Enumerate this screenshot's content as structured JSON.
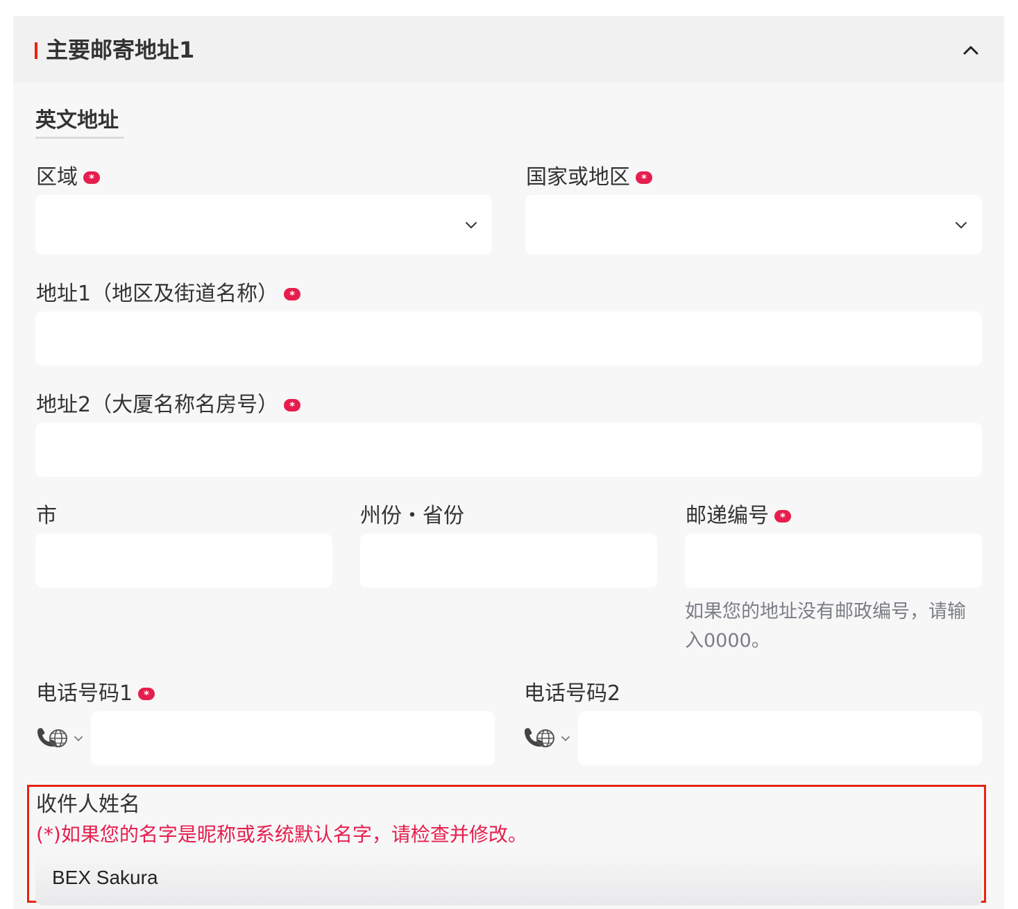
{
  "section": {
    "title": "主要邮寄地址1",
    "collapse_icon": "chevron-up-icon",
    "accent_color": "#e8230f"
  },
  "subsection": {
    "title": "英文地址"
  },
  "required_marker": "*",
  "fields": {
    "region": {
      "label": "区域",
      "value": "",
      "icon": "chevron-down-icon"
    },
    "country": {
      "label": "国家或地区",
      "value": "",
      "icon": "chevron-down-icon"
    },
    "address1": {
      "label": "地址1（地区及街道名称）",
      "value": ""
    },
    "address2": {
      "label": "地址2（大厦名称名房号）",
      "value": ""
    },
    "city": {
      "label": "市",
      "value": ""
    },
    "state": {
      "label": "州份・省份",
      "value": ""
    },
    "postal": {
      "label": "邮递编号",
      "value": "",
      "hint": "如果您的地址没有邮政编号，请输入0000。"
    },
    "phone1": {
      "label": "电话号码1",
      "value": "",
      "prefix_icon": "phone-globe-icon"
    },
    "phone2": {
      "label": "电话号码2",
      "value": "",
      "prefix_icon": "phone-globe-icon"
    },
    "recipient": {
      "label": "收件人姓名",
      "note": "(*)如果您的名字是昵称或系统默认名字，请检查并修改。",
      "value": "BEX Sakura"
    }
  },
  "colors": {
    "required_badge": "#e61e4d",
    "highlight_border": "#e8230f",
    "hint_text": "#7b7e85"
  }
}
